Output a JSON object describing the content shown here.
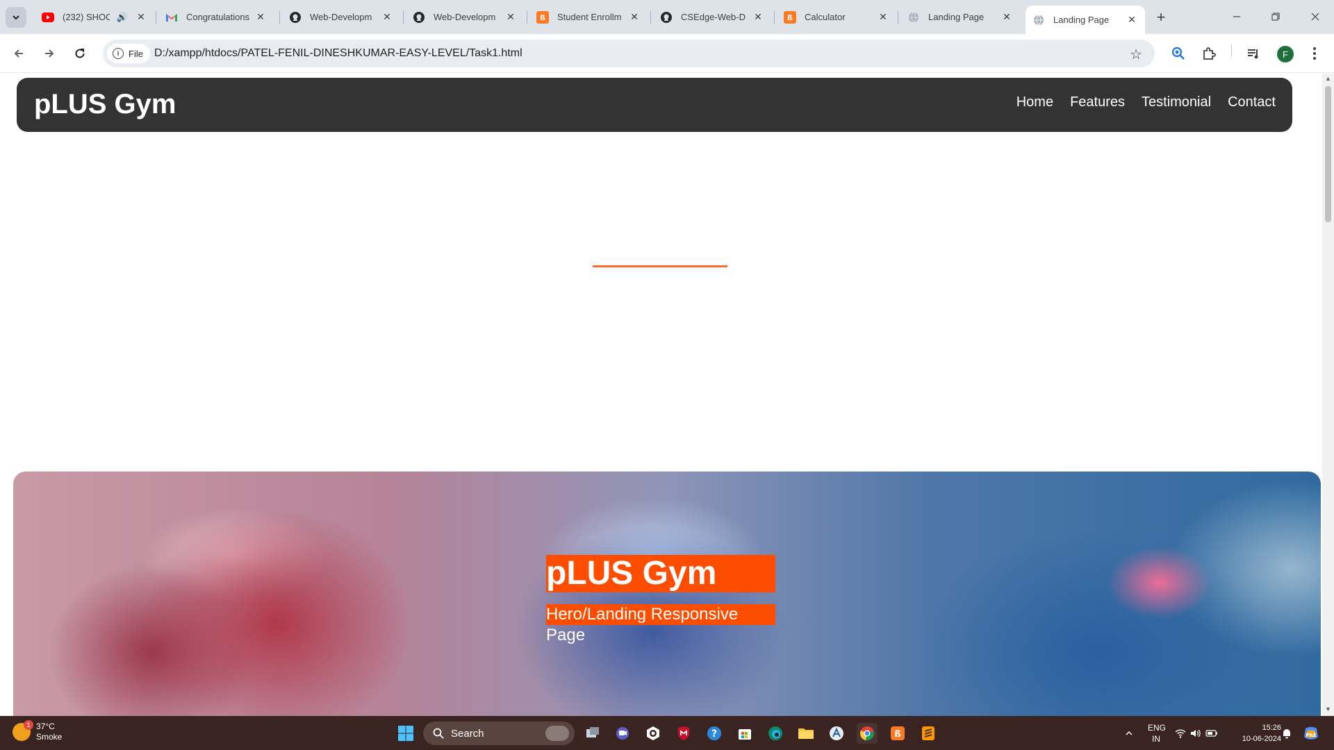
{
  "browser": {
    "tabs": [
      {
        "title": "(232) SHOO",
        "favicon": "youtube-icon",
        "audio": true
      },
      {
        "title": "Congratulations",
        "favicon": "gmail-icon"
      },
      {
        "title": "Web-Developm",
        "favicon": "github-icon"
      },
      {
        "title": "Web-Developm",
        "favicon": "github-icon"
      },
      {
        "title": "Student Enrollm",
        "favicon": "xampp-icon"
      },
      {
        "title": "CSEdge-Web-D",
        "favicon": "github-icon"
      },
      {
        "title": "Calculator",
        "favicon": "xampp-icon"
      },
      {
        "title": "Landing Page",
        "favicon": "globe-icon"
      },
      {
        "title": "Landing Page",
        "favicon": "globe-icon",
        "active": true
      }
    ],
    "site_chip": "File",
    "url": "D:/xampp/htdocs/PATEL-FENIL-DINESHKUMAR-EASY-LEVEL/Task1.html",
    "profile_initial": "F"
  },
  "page": {
    "brand": "pLUS Gym",
    "nav": [
      "Home",
      "Features",
      "Testimonial",
      "Contact"
    ],
    "hero_title": "pLUS Gym",
    "hero_subtitle": "Hero/Landing Responsive Page",
    "colors": {
      "nav_bg": "#333333",
      "accent": "#ff4d00",
      "accent_line": "#ff6a33"
    }
  },
  "taskbar": {
    "weather_temp": "37°C",
    "weather_desc": "Smoke",
    "weather_badge": "1",
    "search_label": "Search",
    "lang_line1": "ENG",
    "lang_line2": "IN",
    "time": "15:26",
    "date": "10-06-2024"
  }
}
